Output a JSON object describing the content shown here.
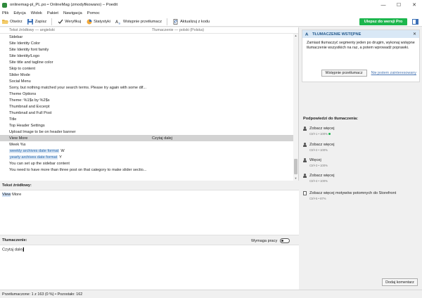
{
  "window": {
    "title": "onlinemag-pl_PL.po • OnlineMag (zmodyfikowano) – Poedit",
    "controls": [
      "—",
      "☐",
      "✕"
    ]
  },
  "menu": [
    "Plik",
    "Edycja",
    "Widok",
    "Pakiet",
    "Nawigacja",
    "Pomoc"
  ],
  "toolbar": {
    "open": "Otwórz",
    "save": "Zapisz",
    "validate": "Weryfikuj",
    "stats": "Statystyki",
    "pretranslate": "Wstępnie przetłumacz",
    "update": "Aktualizuj z kodu",
    "upgrade": "Ulepsz do wersji Pro"
  },
  "list": {
    "header_source": "Tekst źródłowy — angielski",
    "header_target": "Tłumaczenie — polski (Polska)",
    "rows": [
      {
        "src": "Sidebar",
        "tgt": ""
      },
      {
        "src": "Site Identity Color",
        "tgt": ""
      },
      {
        "src": "Site Identity font family",
        "tgt": ""
      },
      {
        "src": "Site Identity/Logo",
        "tgt": ""
      },
      {
        "src": "Site title and tagline color",
        "tgt": ""
      },
      {
        "src": "Skip to content",
        "tgt": ""
      },
      {
        "src": "Slider Mode",
        "tgt": ""
      },
      {
        "src": "Social Menu",
        "tgt": ""
      },
      {
        "src": "Sorry, but nothing matched your search terms. Please try again with some dif...",
        "tgt": ""
      },
      {
        "src": "Theme Options",
        "tgt": ""
      },
      {
        "src": "Theme: %1$s by %2$s",
        "tgt": ""
      },
      {
        "src": "Thumbnail and Excerpt",
        "tgt": ""
      },
      {
        "src": "Thumbnail and Full Post",
        "tgt": ""
      },
      {
        "src": "Title",
        "tgt": ""
      },
      {
        "src": "Top Header Settings",
        "tgt": ""
      },
      {
        "src": "Upload Image to be on header banner",
        "tgt": ""
      },
      {
        "src": "View More",
        "tgt": "Czytaj dalej"
      },
      {
        "src": "Week %s",
        "tgt": ""
      },
      {
        "src_tag": "weekly archives date format",
        "src_after": "W",
        "tgt": ""
      },
      {
        "src_tag": "yearly archives date format",
        "src_after": "Y",
        "tgt": ""
      },
      {
        "src": "You can set up the sidebar content",
        "tgt": ""
      },
      {
        "src": "You need to have more than three post on that category to make slider sectio...",
        "tgt": ""
      }
    ]
  },
  "source_panel": {
    "label": "Tekst źródłowy:",
    "highlight": "View",
    "rest": " More"
  },
  "translation_panel": {
    "label": "Tłumaczenie:",
    "needs_work": "Wymaga pracy",
    "value": "Czytaj dalej"
  },
  "pretranslate_card": {
    "title": "TŁUMACZENIE WSTĘPNE",
    "close": "✕",
    "body": "Zamiast tłumaczyć segmenty jeden po drugim, wykonaj wstępne tłumaczenie wszystkich na raz, a potem wprowadź poprawki.",
    "button": "Wstępnie przetłumacz",
    "link": "Nie jestem zainteresowany"
  },
  "suggestions": {
    "title": "Podpowiedzi do tłumaczenia:",
    "items": [
      {
        "text": "Zobacz więcej",
        "meta": "Ctrl+1 • 100%",
        "icon": "person-icon"
      },
      {
        "text": "Zobacz więcej",
        "meta": "Ctrl+2 • 100%",
        "icon": "person-icon"
      },
      {
        "text": "Więcej",
        "meta": "Ctrl+3 • 100%",
        "icon": "person-icon"
      },
      {
        "text": "Zobacz więcej",
        "meta": "Ctrl+4 • 100%",
        "icon": "person-icon"
      },
      {
        "text": "Zobacz więcej motywów potomnych do Storefront",
        "meta": "Ctrl+5 • 87%",
        "icon": "document-icon"
      }
    ]
  },
  "add_comment": "Dodaj komentarz",
  "status": "Przetłumaczone: 1 z 163 (0 %)  •  Pozostało: 162",
  "colors": {
    "accent_green": "#1cb64d",
    "selection": "#d3d3d3",
    "card_header": "#d9e8f6"
  }
}
